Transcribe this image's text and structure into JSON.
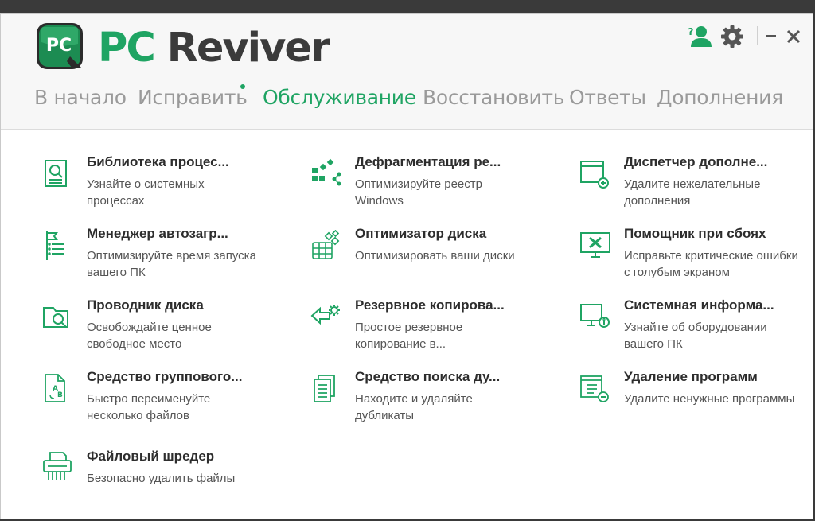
{
  "app": {
    "logo_badge": "PC",
    "logo_pc": "PC",
    "logo_reviver": "Reviver",
    "brand_color": "#1fa463"
  },
  "top_icons": [
    "help-user-icon",
    "gear-icon",
    "minimize-icon",
    "close-icon"
  ],
  "nav": [
    {
      "label": "В начало",
      "active": false
    },
    {
      "label": "Исправить",
      "active": false,
      "dot": true
    },
    {
      "label": "Обслуживание",
      "active": true
    },
    {
      "label": "Восстановить",
      "active": false
    },
    {
      "label": "Ответы",
      "active": false
    },
    {
      "label": "Дополнения",
      "active": false
    }
  ],
  "tools": [
    {
      "title": "Библиотека процес...",
      "desc": "Узнайте о системных процессах",
      "icon": "process-library-icon"
    },
    {
      "title": "Дефрагментация ре...",
      "desc": "Оптимизируйте реестр Windows",
      "icon": "registry-defrag-icon"
    },
    {
      "title": "Диспетчер дополне...",
      "desc": "Удалите нежелательные дополнения",
      "icon": "addon-manager-icon"
    },
    {
      "title": "Менеджер автозагр...",
      "desc": "Оптимизируйте время запуска вашего ПК",
      "icon": "startup-manager-icon"
    },
    {
      "title": "Оптимизатор диска",
      "desc": "Оптимизировать ваши диски",
      "icon": "disk-optimizer-icon"
    },
    {
      "title": "Помощник при сбоях",
      "desc": "Исправьте критические ошибки с голубым экраном",
      "icon": "crash-helper-icon"
    },
    {
      "title": "Проводник диска",
      "desc": "Освобождайте ценное свободное место",
      "icon": "disk-explorer-icon"
    },
    {
      "title": "Резервное копирова...",
      "desc": "Простое резервное копирование в...",
      "icon": "backup-icon"
    },
    {
      "title": "Системная информа...",
      "desc": "Узнайте об оборудовании вашего ПК",
      "icon": "system-info-icon"
    },
    {
      "title": "Средство группового...",
      "desc": "Быстро переименуйте несколько файлов",
      "icon": "bulk-rename-icon"
    },
    {
      "title": "Средство поиска ду...",
      "desc": "Находите и удаляйте дубликаты",
      "icon": "duplicate-finder-icon"
    },
    {
      "title": "Удаление программ",
      "desc": "Удалите ненужные программы",
      "icon": "uninstaller-icon"
    },
    {
      "title": "Файловый шредер",
      "desc": "Безопасно удалить файлы",
      "icon": "file-shredder-icon"
    }
  ]
}
